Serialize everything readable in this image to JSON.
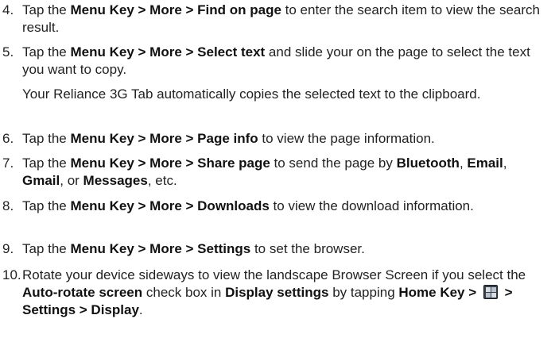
{
  "steps": [
    {
      "number": "4.",
      "parts": [
        {
          "t": "Tap the "
        },
        {
          "b": "Menu Key > More > Find on page"
        },
        {
          "t": " to enter the search item to view the search result."
        }
      ]
    },
    {
      "number": "5.",
      "parts": [
        {
          "t": "Tap the "
        },
        {
          "b": "Menu Key > More > Select text"
        },
        {
          "t": " and slide your on the page to select the text you want to copy."
        }
      ],
      "note": "Your Reliance 3G Tab automatically copies the selected text to the clipboard."
    },
    {
      "number": "6.",
      "parts": [
        {
          "t": "Tap the "
        },
        {
          "b": "Menu Key > More > Page info"
        },
        {
          "t": " to view the page information."
        }
      ]
    },
    {
      "number": "7.",
      "parts": [
        {
          "t": "Tap the "
        },
        {
          "b": "Menu Key > More > Share page"
        },
        {
          "t": " to send the page by "
        },
        {
          "b": "Bluetooth"
        },
        {
          "t": ", "
        },
        {
          "b": "Email"
        },
        {
          "t": ", "
        },
        {
          "b": "Gmail"
        },
        {
          "t": ", or "
        },
        {
          "b": "Messages"
        },
        {
          "t": ", etc."
        }
      ]
    },
    {
      "number": "8.",
      "parts": [
        {
          "t": "Tap the "
        },
        {
          "b": "Menu Key > More > Downloads"
        },
        {
          "t": " to view the download information."
        }
      ]
    },
    {
      "number": "9.",
      "parts": [
        {
          "t": "Tap the "
        },
        {
          "b": "Menu Key > More > Settings"
        },
        {
          "t": " to set the browser."
        }
      ]
    },
    {
      "number": "10.",
      "parts": [
        {
          "t": "Rotate your device sideways to view the landscape Browser Screen if you select the "
        },
        {
          "b": "Auto-rotate screen"
        },
        {
          "t": " check box in "
        },
        {
          "b": "Display settings"
        },
        {
          "t": " by tapping "
        },
        {
          "b": "Home Key > "
        },
        {
          "icon": "apps-grid-icon"
        },
        {
          "b": " > Settings > Display"
        },
        {
          "t": "."
        }
      ]
    }
  ]
}
